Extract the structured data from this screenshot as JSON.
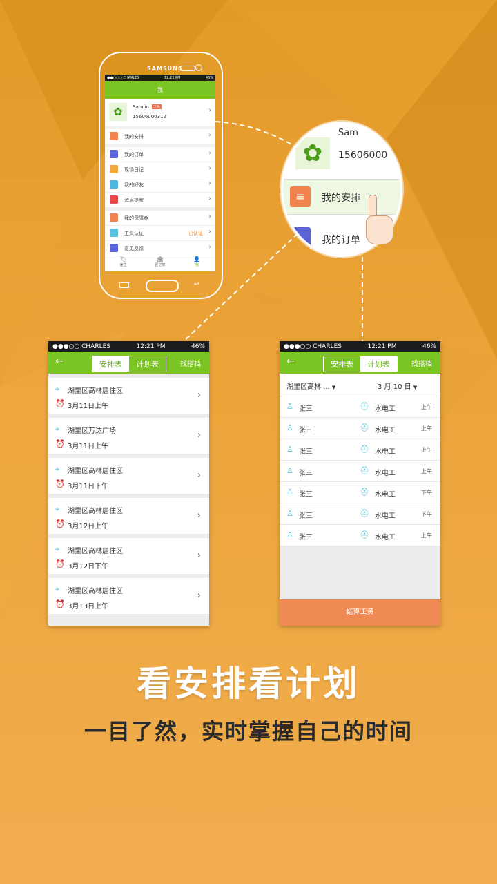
{
  "colors": {
    "green": "#7ac424",
    "orange_btn": "#f08a55",
    "accent_blue": "#46bcd8",
    "accent_red": "#f2734e"
  },
  "phone_small": {
    "brand": "SAMSUNG",
    "status": {
      "carrier": "●●○○○ CHARLES",
      "time": "12:21 PM",
      "battery": "46%"
    },
    "title": "我",
    "profile": {
      "name": "Samlin",
      "badge": "工头",
      "phone": "15606000312"
    },
    "menu": [
      {
        "label": "我的安排",
        "icon": "list-icon"
      },
      {
        "label": "我的订单",
        "icon": "tag-icon"
      },
      {
        "label": "现场日记",
        "icon": "diary-icon"
      },
      {
        "label": "我的好友",
        "icon": "friends-icon"
      },
      {
        "label": "消息提醒",
        "icon": "message-icon"
      },
      {
        "label": "我的保障金",
        "icon": "money-icon"
      },
      {
        "label": "工头认证",
        "icon": "shield-icon",
        "status": "已认证"
      },
      {
        "label": "意见反馈",
        "icon": "mail-icon"
      }
    ],
    "tabbar": [
      {
        "label": "雇主"
      },
      {
        "label": "匠之家"
      },
      {
        "label": "我"
      }
    ]
  },
  "zoom": {
    "phone": "15606000",
    "partial_name": "Sam",
    "item1": "我的安排",
    "item2": "我的订单"
  },
  "schedule_screen": {
    "status": {
      "carrier": "●●●○○ CHARLES",
      "time": "12:21 PM",
      "battery": "46%"
    },
    "tabs": [
      "安排表",
      "计划表"
    ],
    "right_action": "找搭档",
    "items": [
      {
        "location": "湖里区高林居住区",
        "time": "3月11日上午"
      },
      {
        "location": "湖里区万达广场",
        "time": "3月11日上午"
      },
      {
        "location": "湖里区高林居住区",
        "time": "3月11日下午"
      },
      {
        "location": "湖里区高林居住区",
        "time": "3月12日上午"
      },
      {
        "location": "湖里区高林居住区",
        "time": "3月12日下午"
      },
      {
        "location": "湖里区高林居住区",
        "time": "3月13日上午"
      }
    ]
  },
  "plan_screen": {
    "status": {
      "carrier": "●●●○○ CHARLES",
      "time": "12:21 PM",
      "battery": "46%"
    },
    "tabs": [
      "安排表",
      "计划表"
    ],
    "right_action": "找搭档",
    "filter_area": "湖里区高林 ...",
    "filter_date": "3 月 10 日",
    "rows": [
      {
        "name": "张三",
        "work": "水电工",
        "period": "上午"
      },
      {
        "name": "张三",
        "work": "水电工",
        "period": "上午"
      },
      {
        "name": "张三",
        "work": "水电工",
        "period": "上午"
      },
      {
        "name": "张三",
        "work": "水电工",
        "period": "上午"
      },
      {
        "name": "张三",
        "work": "水电工",
        "period": "下午"
      },
      {
        "name": "张三",
        "work": "水电工",
        "period": "下午"
      },
      {
        "name": "张三",
        "work": "水电工",
        "period": "上午"
      }
    ],
    "settle_button": "结算工资"
  },
  "headline": "看安排看计划",
  "subline": "一目了然，实时掌握自己的时间"
}
